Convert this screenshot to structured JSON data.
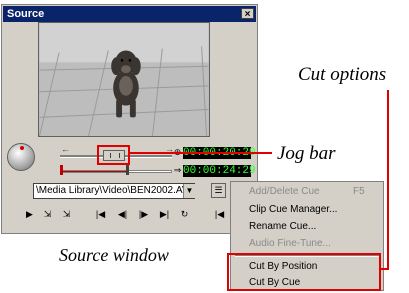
{
  "window": {
    "title": "Source",
    "close_glyph": "×"
  },
  "timecodes": {
    "current": "00:00:20:20",
    "duration": "00:00:24:29"
  },
  "file_path": "\\Media Library\\Video\\BEN2002.AVI",
  "jog_position": 0.45,
  "trim_range": [
    0.0,
    0.6
  ],
  "menu": {
    "items": [
      {
        "label": "Add/Delete Cue",
        "shortcut": "F5",
        "disabled": true
      },
      {
        "label": "Clip Cue Manager...",
        "disabled": false
      },
      {
        "label": "Rename Cue...",
        "disabled": false
      },
      {
        "label": "Audio Fine-Tune...",
        "disabled": true
      },
      {
        "label": "Cut By Position",
        "disabled": false
      },
      {
        "label": "Cut By Cue",
        "disabled": false
      }
    ]
  },
  "callouts": {
    "cut_options": "Cut options",
    "jog_bar": "Jog bar",
    "source_window": "Source window"
  },
  "icons": [
    "close-icon",
    "jog-dial-icon",
    "clock-icon",
    "duration-icon",
    "dropdown-arrow-icon",
    "options-icon",
    "play-icon",
    "mark-in-icon",
    "mark-out-icon",
    "go-to-start-icon",
    "step-back-icon",
    "step-forward-icon",
    "go-to-end-icon",
    "loop-icon"
  ],
  "colors": {
    "highlight": "#e00000",
    "timecode_text": "#33ff33",
    "title_bar": "#0a246a"
  }
}
